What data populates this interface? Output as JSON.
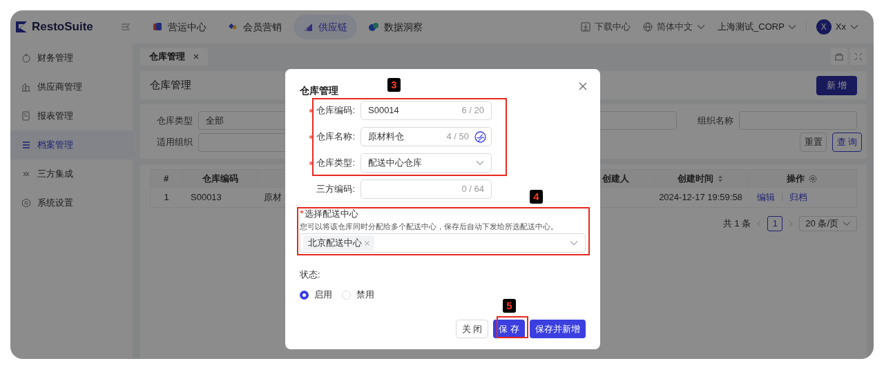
{
  "app": {
    "logo": "RestoSuite"
  },
  "top_nav": [
    {
      "label": "营运中心",
      "selected": false
    },
    {
      "label": "会员营销",
      "selected": false
    },
    {
      "label": "供应链",
      "selected": true
    },
    {
      "label": "数据洞察",
      "selected": false
    }
  ],
  "header_right": {
    "download": "下载中心",
    "language": "简体中文",
    "org": "上海测试_CORP",
    "avatar": "X",
    "user": "Xx"
  },
  "sidebar": [
    {
      "label": "财务管理",
      "selected": false
    },
    {
      "label": "供应商管理",
      "selected": false
    },
    {
      "label": "报表管理",
      "selected": false
    },
    {
      "label": "档案管理",
      "selected": true
    },
    {
      "label": "三方集成",
      "selected": false
    },
    {
      "label": "系统设置",
      "selected": false
    }
  ],
  "tabs": [
    {
      "label": "仓库管理",
      "selected": true
    }
  ],
  "page_title": "仓库管理",
  "add_button": "新 增",
  "filters": {
    "row1": [
      {
        "label": "仓库类型",
        "value": "全部"
      },
      {
        "label": "组织名称"
      }
    ],
    "row2": [
      {
        "label": "适用组织"
      }
    ],
    "buttons": [
      {
        "label": "重置",
        "kind": "default"
      },
      {
        "label": "查 询",
        "kind": "outline"
      }
    ]
  },
  "table": {
    "columns": [
      "#",
      "仓库编码",
      "创建人",
      "创建时间",
      "操作"
    ],
    "rows": [
      {
        "index": "1",
        "code": "S00013",
        "name": "原材",
        "created_at": "2024-12-17 19:59:58",
        "actions": [
          "编辑",
          "归档"
        ]
      }
    ]
  },
  "pagination": {
    "total": "共 1 条",
    "page": "1",
    "page_size": "20 条/页"
  },
  "dialog": {
    "title": "仓库管理",
    "fields": [
      {
        "label": "仓库编码:",
        "required": true,
        "kind": "text",
        "value": "S00014",
        "count": "6 / 20"
      },
      {
        "label": "仓库名称:",
        "required": true,
        "kind": "translatable",
        "value": "原材料仓",
        "count": "4 / 50"
      },
      {
        "label": "仓库类型:",
        "required": true,
        "kind": "select",
        "value": "配送中心仓库"
      },
      {
        "label": "三方编码:",
        "required": false,
        "kind": "text",
        "count": "0 / 64"
      }
    ],
    "distribution": {
      "label": "选择配送中心",
      "required": true,
      "hint": "您可以将该仓库同时分配给多个配送中心，保存后自动下发给所选配送中心。",
      "tags": [
        "北京配送中心"
      ]
    },
    "status": {
      "label": "状态:",
      "options": [
        {
          "label": "启用",
          "selected": true
        },
        {
          "label": "禁用",
          "selected": false
        }
      ]
    },
    "buttons": [
      {
        "label": "关 闭",
        "kind": "default"
      },
      {
        "label": "保 存",
        "kind": "primary"
      },
      {
        "label": "保存并新增",
        "kind": "primary"
      }
    ]
  },
  "annotations": [
    {
      "label": "3"
    },
    {
      "label": "4"
    },
    {
      "label": "5"
    }
  ]
}
